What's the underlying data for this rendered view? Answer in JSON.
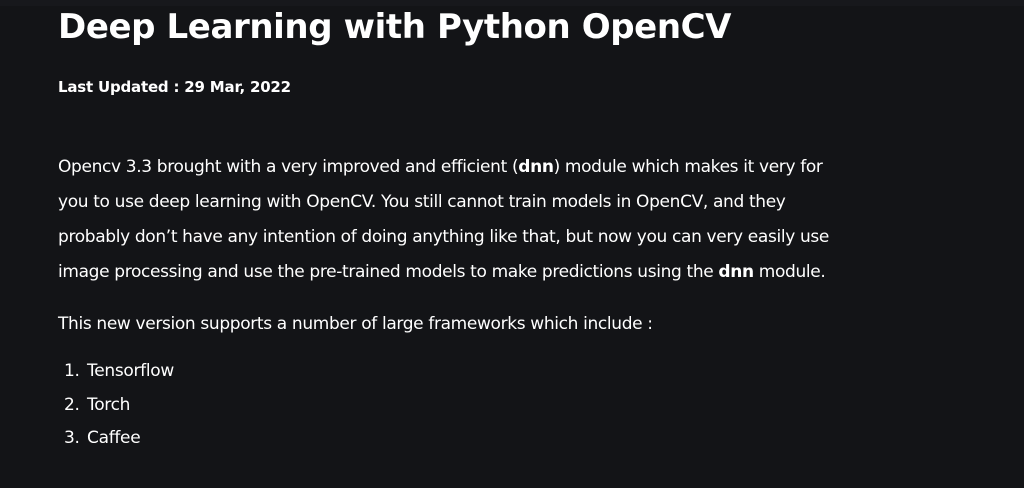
{
  "article": {
    "title": "Deep Learning with Python OpenCV",
    "last_updated": "Last Updated : 29 Mar, 2022",
    "paragraph1": {
      "line1_a": "Opencv 3.3 brought with a very improved and efficient (",
      "line1_bold": "dnn",
      "line1_b": ") module which makes it very for",
      "line2": "you to use deep learning with OpenCV. You still cannot train models in OpenCV, and they",
      "line3": "probably don’t have any intention of doing anything like that, but now you can very easily use",
      "line4_a": "image processing and use the pre-trained models to make predictions using the ",
      "line4_bold": "dnn",
      "line4_b": " module."
    },
    "paragraph2": "This new version supports a number of large frameworks which include :",
    "frameworks": [
      {
        "number": "1.",
        "name": "Tensorflow"
      },
      {
        "number": "2.",
        "name": "Torch"
      },
      {
        "number": "3.",
        "name": "Caffee"
      }
    ]
  }
}
